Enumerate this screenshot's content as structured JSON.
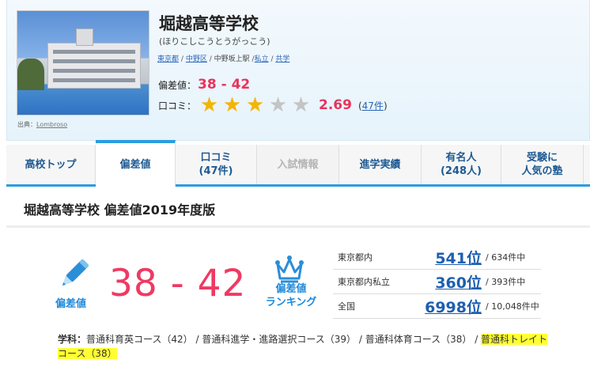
{
  "school": {
    "name": "堀越高等学校",
    "kana": "(ほりこしこうとうがっこう)",
    "prefecture": "東京都",
    "ward": "中野区",
    "station": "中野坂上駅",
    "type": "私立",
    "gender": "共学",
    "photo_credit_label": "出典：",
    "photo_credit_source": "Lombroso"
  },
  "summary": {
    "hensachi_label": "偏差値：",
    "hensachi_value": "38 - 42",
    "kuchikomi_label": "口コミ：",
    "rating": 2.69,
    "rating_text": "2.69",
    "stars_filled": 3,
    "stars_total": 5,
    "review_count_text": "47件"
  },
  "tabs": [
    {
      "label": "高校トップ"
    },
    {
      "label": "偏差値"
    },
    {
      "label": "口コミ\n(47件)"
    },
    {
      "label": "入試情報"
    },
    {
      "label": "進学実績"
    },
    {
      "label": "有名人\n(248人)"
    },
    {
      "label": "受験に\n人気の塾"
    }
  ],
  "main": {
    "title": "堀越高等学校 偏差値2019年度版",
    "hensachi_label": "偏差値",
    "hensachi_range": "38 - 42",
    "ranking_label_1": "偏差値",
    "ranking_label_2": "ランキング",
    "rankings": [
      {
        "category": "東京都内",
        "position": "541位",
        "total": "/ 634件中"
      },
      {
        "category": "東京都内私立",
        "position": "360位",
        "total": "/ 393件中"
      },
      {
        "category": "全国",
        "position": "6998位",
        "total": "/ 10,048件中"
      }
    ],
    "courses_label": "学科：",
    "courses": [
      "普通科育英コース（42）",
      "普通科進学・進路選択コース（39）",
      "普通科体育コース（38）",
      "普通科トレイトコース（38）"
    ]
  },
  "colors": {
    "accent_blue": "#2b9de0",
    "link_blue": "#1d5fb0",
    "hensachi_pink": "#ee3a63",
    "star_gold": "#f4b400",
    "highlight_yellow": "#ffff33"
  }
}
